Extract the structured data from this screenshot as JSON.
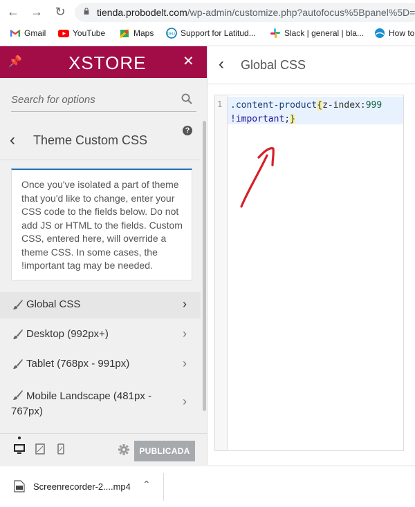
{
  "browser": {
    "url_host": "tienda.probodelt.com",
    "url_path": "/wp-admin/customize.php?autofocus%5Bpanel%5D=",
    "bookmarks": [
      {
        "label": "Gmail",
        "icon": "gmail-icon"
      },
      {
        "label": "YouTube",
        "icon": "youtube-icon"
      },
      {
        "label": "Maps",
        "icon": "maps-icon"
      },
      {
        "label": "Support for Latitud...",
        "icon": "dell-icon"
      },
      {
        "label": "Slack | general | bla...",
        "icon": "slack-icon"
      },
      {
        "label": "How to",
        "icon": "globe-icon"
      }
    ]
  },
  "sidebar": {
    "brand": "XSTORE",
    "search_placeholder": "Search for options",
    "section_title": "Theme Custom CSS",
    "help": "?",
    "description": "Once you've isolated a part of theme that you'd like to change, enter your CSS code to the fields below. Do not add JS or HTML to the fields. Custom CSS, entered here, will override a theme CSS. In some cases, the !important tag may be needed.",
    "items": [
      {
        "label": "Global CSS"
      },
      {
        "label": "Desktop (992px+)"
      },
      {
        "label": "Tablet (768px - 991px)"
      },
      {
        "label": "Mobile Landscape (481px - 767px)"
      }
    ],
    "publish_label": "PUBLICADA"
  },
  "editor": {
    "title": "Global CSS",
    "line_number": "1",
    "selector": ".content-product",
    "brace_open": "{",
    "property": "z-index:",
    "value": "999",
    "important": "!important",
    "tail": ";",
    "brace_close": "}"
  },
  "downloads": {
    "file_name": "Screenrecorder-2....mp4"
  },
  "colors": {
    "brand": "#a20c47",
    "annotation_arrow": "#d6202a"
  }
}
